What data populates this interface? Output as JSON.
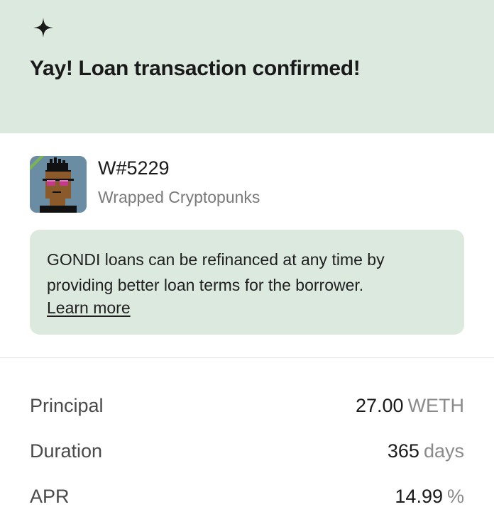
{
  "header": {
    "icon": "sparkle-icon",
    "title": "Yay! Loan transaction confirmed!",
    "background": "#dce9df"
  },
  "nft": {
    "name": "W#5229",
    "collection": "Wrapped Cryptopunks",
    "thumbnail_icon": "cryptopunk-avatar"
  },
  "info": {
    "text": "GONDI loans can be refinanced at any time by providing better loan terms for the borrower.",
    "link_label": "Learn more"
  },
  "details": [
    {
      "label": "Principal",
      "value": "27.00",
      "unit": "WETH"
    },
    {
      "label": "Duration",
      "value": "365",
      "unit": "days"
    },
    {
      "label": "APR",
      "value": "14.99",
      "unit": "%"
    }
  ]
}
